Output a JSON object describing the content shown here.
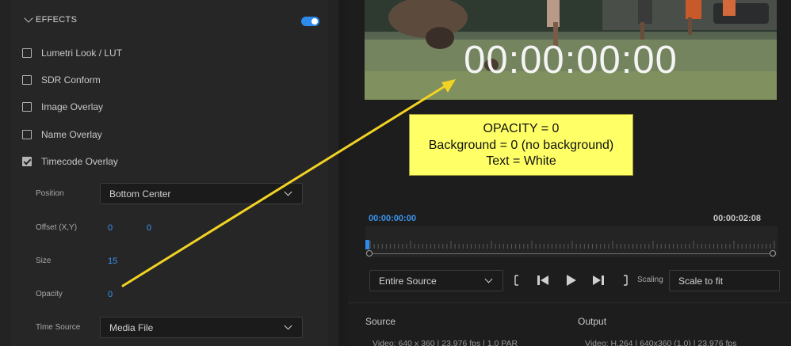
{
  "effects": {
    "title": "EFFECTS",
    "enabled": true,
    "items": [
      {
        "label": "Lumetri Look / LUT",
        "checked": false
      },
      {
        "label": "SDR Conform",
        "checked": false
      },
      {
        "label": "Image Overlay",
        "checked": false
      },
      {
        "label": "Name Overlay",
        "checked": false
      },
      {
        "label": "Timecode Overlay",
        "checked": true
      }
    ],
    "timecode_settings": {
      "position_label": "Position",
      "position_value": "Bottom Center",
      "offset_label": "Offset (X,Y)",
      "offset_x": "0",
      "offset_y": "0",
      "size_label": "Size",
      "size_value": "15",
      "opacity_label": "Opacity",
      "opacity_value": "0",
      "time_source_label": "Time Source",
      "time_source_value": "Media File"
    }
  },
  "preview": {
    "timecode_overlay": "00:00:00:00",
    "annotation": {
      "line1": "OPACITY = 0",
      "line2": "Background = 0 (no background)",
      "line3": "Text = White",
      "color": "#ffff66"
    },
    "timeline": {
      "start_tc": "00:00:00:00",
      "end_tc": "00:00:02:08"
    },
    "controls": {
      "range_value": "Entire Source",
      "scaling_label": "Scaling",
      "scaling_value": "Scale to fit"
    },
    "source": {
      "title": "Source",
      "info": "Video:  640 x 360  |  23.976 fps  |  1.0 PAR"
    },
    "output": {
      "title": "Output",
      "info": "Video:  H.264  |  640x360 (1.0)  |  23.976 fps"
    }
  },
  "colors": {
    "accent": "#2d8ceb",
    "value_blue": "#3a95f0",
    "arrow": "#f2d323"
  }
}
